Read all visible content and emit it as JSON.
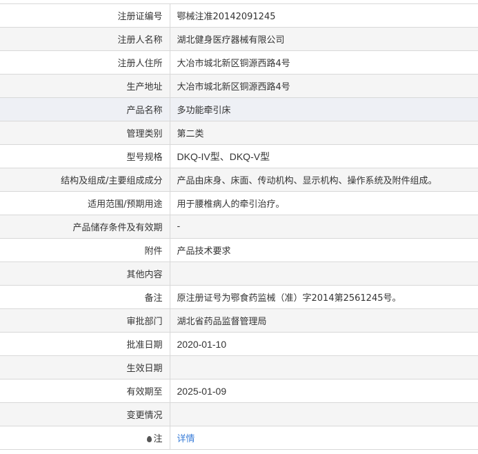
{
  "rows": [
    {
      "label": "注册证编号",
      "value": "鄂械注准20142091245"
    },
    {
      "label": "注册人名称",
      "value": "湖北健身医疗器械有限公司"
    },
    {
      "label": "注册人住所",
      "value": "大冶市城北新区铜源西路4号"
    },
    {
      "label": "生产地址",
      "value": "大冶市城北新区铜源西路4号"
    },
    {
      "label": "产品名称",
      "value": "多功能牵引床"
    },
    {
      "label": "管理类别",
      "value": "第二类"
    },
    {
      "label": "型号规格",
      "value": "DKQ-IV型、DKQ-V型"
    },
    {
      "label": "结构及组成/主要组成成分",
      "value": "产品由床身、床面、传动机构、显示机构、操作系统及附件组成。"
    },
    {
      "label": "适用范围/预期用途",
      "value": "用于腰椎病人的牵引治疗。"
    },
    {
      "label": "产品储存条件及有效期",
      "value": "-"
    },
    {
      "label": "附件",
      "value": "产品技术要求"
    },
    {
      "label": "其他内容",
      "value": ""
    },
    {
      "label": "备注",
      "value": "原注册证号为鄂食药监械（准）字2014第2561245号。"
    },
    {
      "label": "审批部门",
      "value": "湖北省药品监督管理局"
    },
    {
      "label": "批准日期",
      "value": "2020-01-10"
    },
    {
      "label": "生效日期",
      "value": ""
    },
    {
      "label": "有效期至",
      "value": "2025-01-09"
    },
    {
      "label": "变更情况",
      "value": ""
    }
  ],
  "note": {
    "icon": "note-pin-icon",
    "label": "注",
    "link_text": "详情",
    "link_color": "#3a7dd8"
  }
}
